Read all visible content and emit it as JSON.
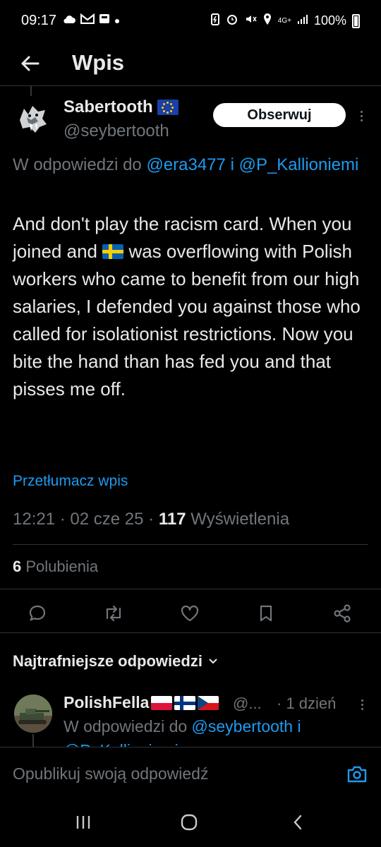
{
  "status_bar": {
    "time": "09:17",
    "network": "4G+",
    "battery": "100%"
  },
  "header": {
    "title": "Wpis"
  },
  "post": {
    "author_name": "Sabertooth",
    "author_handle": "@seybertooth",
    "follow_label": "Obserwuj",
    "reply_prefix": "W odpowiedzi do",
    "reply_mention_1": "@era3477",
    "reply_joiner": "i",
    "reply_mention_2": "@P_Kallioniemi",
    "text_part1": "And don't play the racism card. When you joined and",
    "text_part2": "was overflowing with Polish workers who came to benefit from our high salaries, I defended you against those who called for isolationist restrictions. Now you bite the hand than has fed you and that pisses me off.",
    "translate_label": "Przetłumacz wpis",
    "time": "12:21",
    "date": "02 cze 25",
    "views_count": "117",
    "views_label": "Wyświetlenia",
    "likes_count": "6",
    "likes_label": "Polubienia"
  },
  "replies": {
    "sort_label": "Najtrafniejsze odpowiedzi",
    "items": [
      {
        "author_name": "PolishFella",
        "author_handle": "@...",
        "time": "· 1 dzień",
        "reply_prefix": "W odpowiedzi do",
        "reply_mention_1": "@seybertooth",
        "reply_joiner": "i",
        "reply_mention_2": "@P_Kallioniemi"
      }
    ]
  },
  "composer": {
    "placeholder": "Opublikuj swoją odpowiedź"
  },
  "colors": {
    "background": "#000000",
    "text": "#e7e9ea",
    "secondary": "#71767b",
    "accent": "#1d9bf0",
    "divider": "#2f3336"
  }
}
